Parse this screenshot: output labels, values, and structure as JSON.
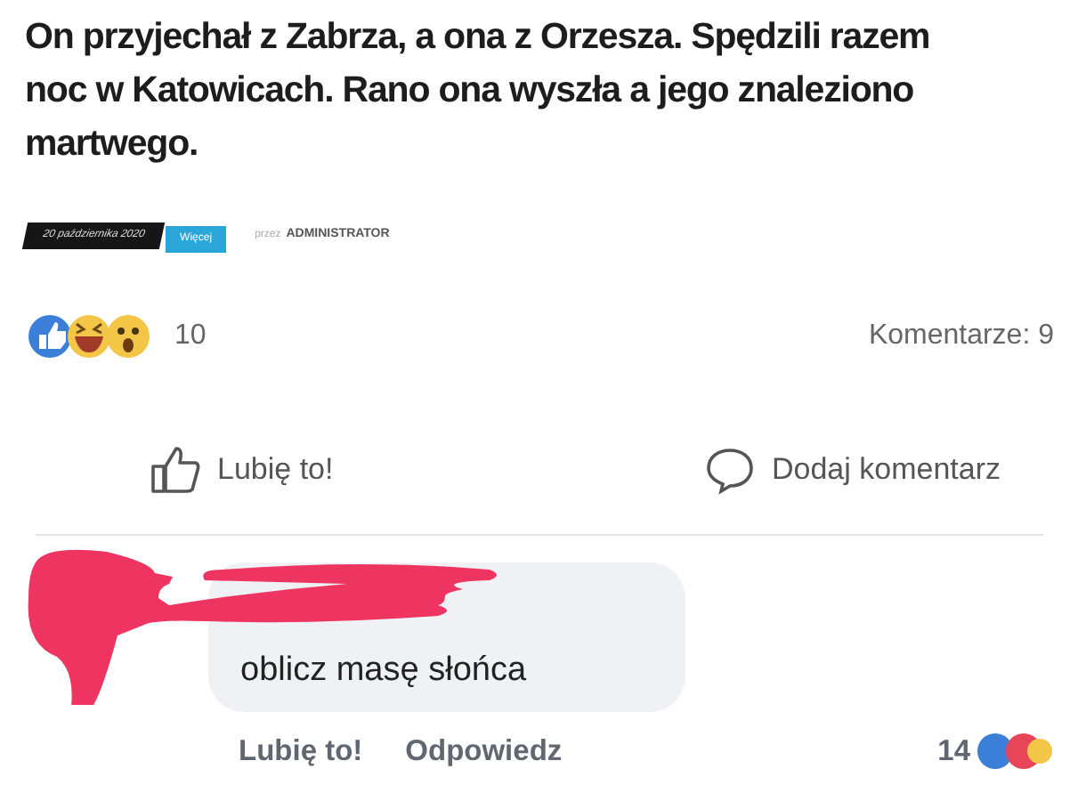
{
  "post": {
    "title": "On przyjechał z Zabrza, a ona z Orzesza. Spędzili razem noc w Katowicach. Rano ona wyszła a jego znaleziono martwego.",
    "date": "20 października 2020",
    "more": "Więcej",
    "author_prefix": "przez",
    "author": "ADMINISTRATOR"
  },
  "reactions": {
    "count": "10",
    "comments": "Komentarze: 9"
  },
  "actions": [
    "Lubię to!",
    "Dodaj komentarz"
  ],
  "comment": {
    "text": "oblicz masę słońca",
    "redacted": true,
    "like": "Lubię to!",
    "reply": "Odpowiedz",
    "reaction_count": "14"
  }
}
